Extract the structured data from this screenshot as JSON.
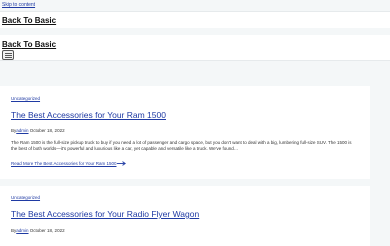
{
  "skip_link": "Skip to content",
  "header": {
    "site_title_primary": "Back To Basic",
    "site_title_secondary": "Back To Basic",
    "menu_icon": "hamburger-icon"
  },
  "posts": [
    {
      "category": "Uncategorized",
      "title": "The Best Accessories for Your Ram 1500",
      "by": "By",
      "author": "admin",
      "date": "October 18, 2022",
      "excerpt": "The Ram 1500 is the full-size pickup truck to buy if you need a lot of passenger and cargo space, but you don't want to deal with a big, lumbering full-size SUV. The 1500 is the best of both worlds—it's powerful and luxurious like a car, yet capable and versatile like a truck. We've found…",
      "read_more": "Read More The Best Accessories for Your Ram 1500"
    },
    {
      "category": "Uncategorized",
      "title": "The Best Accessories for Your Radio Flyer Wagon",
      "by": "By",
      "author": "admin",
      "date": "October 18, 2022"
    }
  ]
}
